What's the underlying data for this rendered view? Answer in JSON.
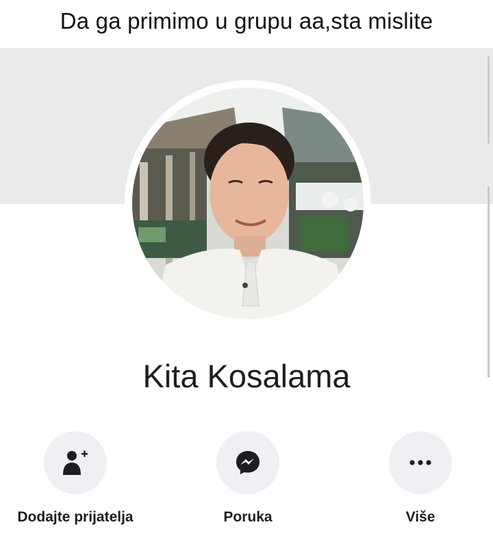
{
  "caption": "Da ga primimo u grupu aa,sta mislite",
  "profile": {
    "name": "Kita Kosalama"
  },
  "actions": [
    {
      "label": "Dodajte prijatelja",
      "icon": "add-friend-icon"
    },
    {
      "label": "Poruka",
      "icon": "messenger-icon"
    },
    {
      "label": "Više",
      "icon": "more-icon"
    }
  ],
  "colors": {
    "cover": "#e9eaec",
    "action_circle": "#eef0f3",
    "text": "#1c1e21"
  }
}
